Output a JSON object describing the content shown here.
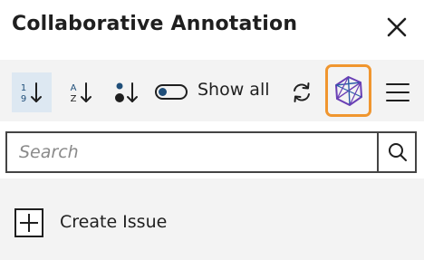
{
  "header": {
    "title": "Collaborative Annotation",
    "close_icon": "close-icon"
  },
  "toolbar": {
    "sort_numeric": {
      "icon": "sort-numeric-icon",
      "top_digit": "1",
      "bottom_digit": "9",
      "active": true
    },
    "sort_alpha": {
      "icon": "sort-alpha-icon",
      "top_letter": "A",
      "bottom_letter": "Z"
    },
    "sort_status": {
      "icon": "sort-status-icon"
    },
    "show_all_label": "Show all",
    "show_all_toggle": {
      "icon": "toggle-icon",
      "on": false
    },
    "refresh_icon": "refresh-icon",
    "logo_icon": "app-logo-icon",
    "menu_icon": "hamburger-menu-icon"
  },
  "search": {
    "placeholder": "Search",
    "value": "",
    "icon": "search-icon"
  },
  "content": {
    "create_issue_label": "Create Issue",
    "create_issue_icon": "plus-box-icon"
  },
  "colors": {
    "accent_orange": "#f0962f",
    "active_bg": "#dde8f2",
    "panel_bg": "#f3f3f3",
    "dark_blue": "#1f4e79",
    "text": "#1f1f1f",
    "logo_purple": "#6a3fb5",
    "logo_blue": "#2b5aa8"
  }
}
